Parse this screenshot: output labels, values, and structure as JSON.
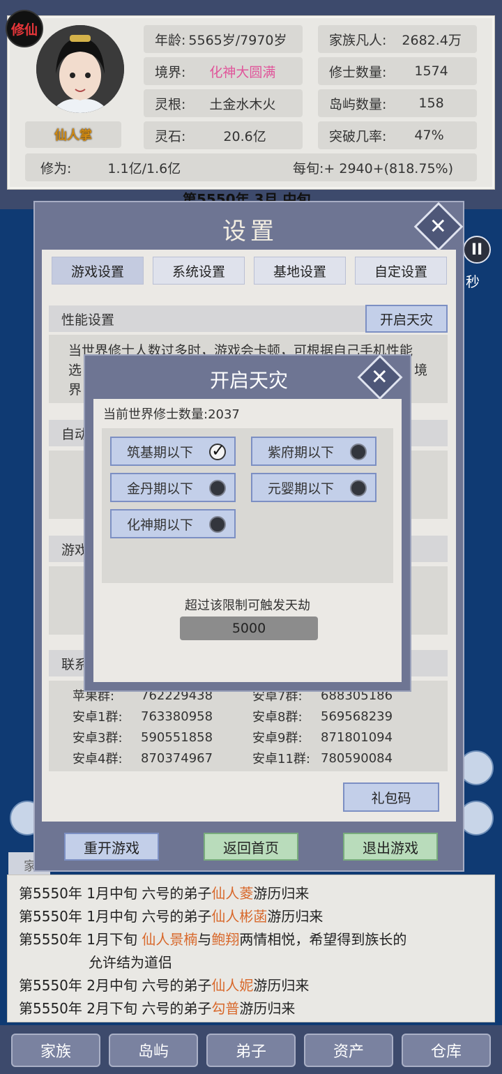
{
  "player": {
    "badge": "修仙",
    "name": "仙人掌",
    "age_label": "年龄:",
    "age_value": "5565岁/7970岁",
    "realm_label": "境界:",
    "realm_value": "化神大圆满",
    "root_label": "灵根:",
    "root_value": "土金水木火",
    "stone_label": "灵石:",
    "stone_value": "20.6亿",
    "cultivation_label": "修为:",
    "cultivation_value": "1.1亿/1.6亿",
    "per_period": "每旬:+ 2940+(818.75%)"
  },
  "clan": {
    "mortals_label": "家族凡人:",
    "mortals_value": "2682.4万",
    "cultivators_label": "修士数量:",
    "cultivators_value": "1574",
    "islands_label": "岛屿数量:",
    "islands_value": "158",
    "breakthrough_label": "突破几率:",
    "breakthrough_value": "47%"
  },
  "date_peek": "第5550年 3月 中旬",
  "side": {
    "pause": "II",
    "seconds": "秒"
  },
  "settings": {
    "title": "设置",
    "tabs": [
      "游戏设置",
      "系统设置",
      "基地设置",
      "自定设置"
    ],
    "perf_head": "性能设置",
    "perf_button": "开启天灾",
    "perf_text_1": "当世界修士人数过多时，游戏会卡顿，可根据自己手机性能",
    "perf_text_2_left": "选",
    "perf_text_2_right": "境",
    "perf_text_3": "界",
    "auto_head_peek": "自动",
    "game_head_peek": "游戏",
    "contact_head_peek": "联系",
    "qq_groups": [
      {
        "label": "苹果群:",
        "value": "762229438"
      },
      {
        "label": "安卓7群:",
        "value": "688305186"
      },
      {
        "label": "安卓1群:",
        "value": "763380958"
      },
      {
        "label": "安卓8群:",
        "value": "569568239"
      },
      {
        "label": "安卓3群:",
        "value": "590551858"
      },
      {
        "label": "安卓9群:",
        "value": "871801094"
      },
      {
        "label": "安卓4群:",
        "value": "870374967"
      },
      {
        "label": "安卓11群:",
        "value": "780590084"
      }
    ],
    "gift_code": "礼包码",
    "restart": "重开游戏",
    "home": "返回首页",
    "exit": "退出游戏"
  },
  "disaster": {
    "title": "开启天灾",
    "current_count": "当前世界修士数量:2037",
    "options": [
      {
        "label": "筑基期以下",
        "checked": true
      },
      {
        "label": "紫府期以下",
        "checked": false
      },
      {
        "label": "金丹期以下",
        "checked": false
      },
      {
        "label": "元婴期以下",
        "checked": false
      },
      {
        "label": "化神期以下",
        "checked": false
      }
    ],
    "limit_hint": "超过该限制可触发天劫",
    "limit_value": "5000"
  },
  "log_tab_peek": "家",
  "log": [
    {
      "date": "第5550年 1月中旬",
      "pre": "六号的弟子",
      "name": "仙人菱",
      "post": "游历归来"
    },
    {
      "date": "第5550年 1月中旬",
      "pre": "六号的弟子",
      "name": "仙人彬菡",
      "post": "游历归来"
    },
    {
      "date": "第5550年 1月下旬",
      "name1": "仙人景楠",
      "mid": "与",
      "name2": "鲍翔",
      "post": "两情相悦，希望得到族长的",
      "cont": "允许结为道侣"
    },
    {
      "date": "第5550年 2月中旬",
      "pre": "六号的弟子",
      "name": "仙人妮",
      "post": "游历归来"
    },
    {
      "date": "第5550年 2月下旬",
      "pre": "六号的弟子",
      "name": "勾普",
      "post": "游历归来"
    }
  ],
  "nav": [
    "家族",
    "岛屿",
    "弟子",
    "资产",
    "仓库"
  ]
}
